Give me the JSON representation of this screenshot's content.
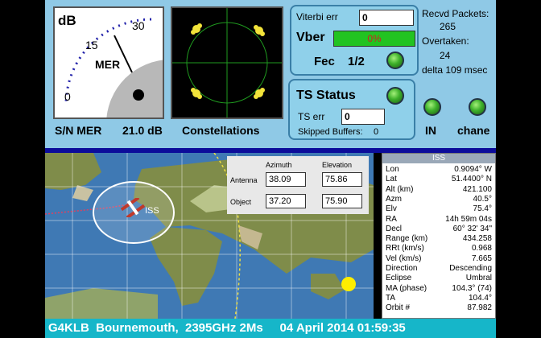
{
  "meter": {
    "unit_label": "dB",
    "scale": [
      "0",
      "15",
      "30"
    ],
    "name": "MER"
  },
  "top": {
    "sn_label": "S/N MER",
    "sn_value": "21.0 dB",
    "constellations_label": "Constellations",
    "viterbi_label": "Viterbi err",
    "viterbi_value": "0",
    "vber_label": "Vber",
    "vber_value": "0%",
    "fec_label": "Fec",
    "fec_value": "1/2",
    "ts_status_label": "TS Status",
    "ts_err_label": "TS err",
    "ts_err_value": "0",
    "skipped_label": "Skipped Buffers:",
    "skipped_value": "0",
    "recvd_label": "Recvd Packets:",
    "recvd_value": "265",
    "overtaken_label": "Overtaken:",
    "overtaken_value": "24",
    "delta_label": "delta 109 msec",
    "in_label": "IN",
    "chanel_label": "chane"
  },
  "tracker": {
    "azimuth_label": "Azimuth",
    "elevation_label": "Elevation",
    "antenna_label": "Antenna",
    "object_label": "Object",
    "antenna_az": "38.09",
    "antenna_el": "75.86",
    "object_az": "37.20",
    "object_el": "75.90",
    "sat_label": "ISS"
  },
  "iss_panel": {
    "title": "ISS",
    "rows": [
      {
        "label": "Lon",
        "value": "0.9094° W"
      },
      {
        "label": "Lat",
        "value": "51.4400° N"
      },
      {
        "label": "Alt (km)",
        "value": "421.100"
      },
      {
        "label": "Azm",
        "value": "40.5°"
      },
      {
        "label": "Elv",
        "value": "75.4°"
      },
      {
        "label": "RA",
        "value": "14h 59m 04s"
      },
      {
        "label": "Decl",
        "value": "60° 32' 34\""
      },
      {
        "label": "Range (km)",
        "value": "434.258"
      },
      {
        "label": "RRt (km/s)",
        "value": "0.968"
      },
      {
        "label": "Vel (km/s)",
        "value": "7.665"
      },
      {
        "label": "Direction",
        "value": "Descending"
      },
      {
        "label": "Eclipse",
        "value": "Umbral"
      },
      {
        "label": "MA (phase)",
        "value": "104.3° (74)"
      },
      {
        "label": "TA",
        "value": "104.4°"
      },
      {
        "label": "Orbit #",
        "value": "87.982"
      }
    ]
  },
  "caption": {
    "text": "G4KLB  Bournemouth,  2395GHz 2Ms     04 April 2014 01:59:35"
  },
  "colors": {
    "panel_bg": "#8fc9e6",
    "vber_bar": "#22c322",
    "vber_text": "#cc2222",
    "caption_bg": "#16b6c9",
    "sep": "#0c0c9a"
  }
}
